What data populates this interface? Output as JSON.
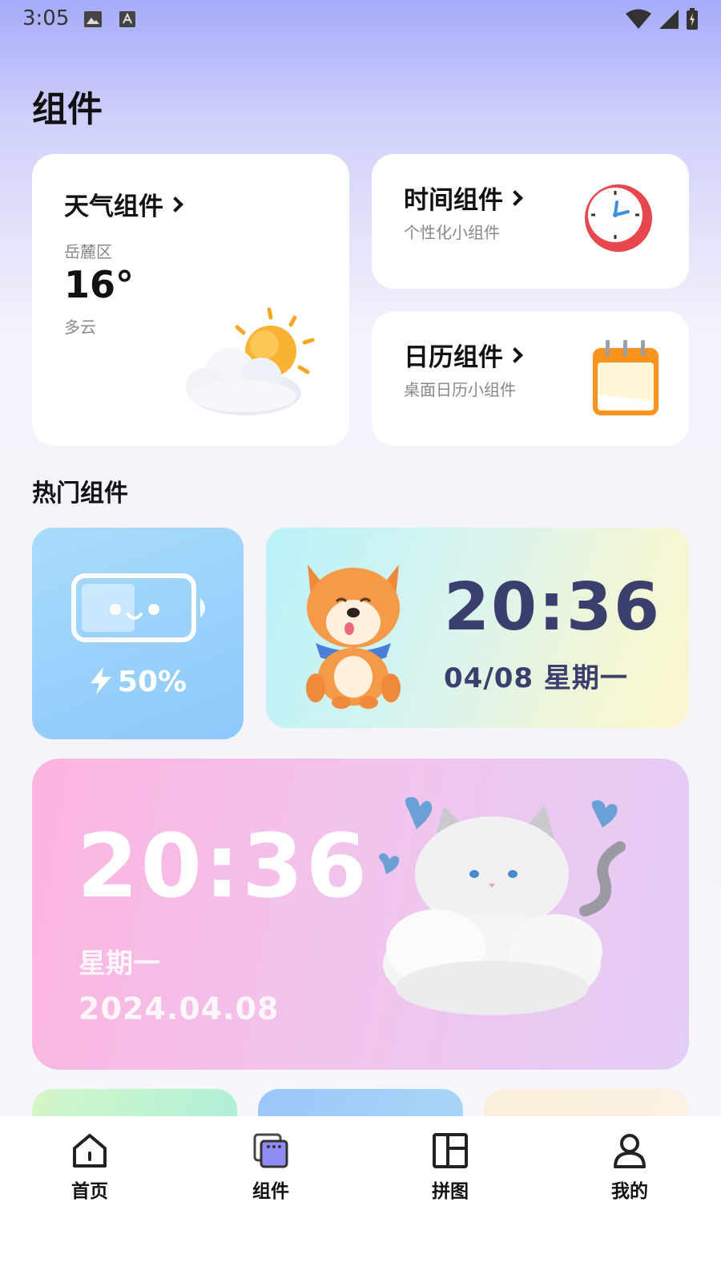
{
  "status_bar": {
    "time": "3:05"
  },
  "page": {
    "title": "组件"
  },
  "cards": {
    "weather": {
      "title": "天气组件",
      "location": "岳麓区",
      "temperature": "16°",
      "condition": "多云"
    },
    "time": {
      "title": "时间组件",
      "subtitle": "个性化小组件"
    },
    "calendar": {
      "title": "日历组件",
      "subtitle": "桌面日历小组件"
    }
  },
  "section": {
    "title": "热门组件"
  },
  "widgets": {
    "battery": {
      "level": "50%"
    },
    "dog_clock": {
      "time": "20:36",
      "date": "04/08  星期一"
    },
    "cat_clock": {
      "time": "20:36",
      "weekday": "星期一",
      "date": "2024.04.08"
    }
  },
  "tabbar": {
    "items": [
      {
        "label": "首页",
        "icon": "home-icon"
      },
      {
        "label": "组件",
        "icon": "widgets-icon",
        "active": true
      },
      {
        "label": "拼图",
        "icon": "puzzle-layout-icon"
      },
      {
        "label": "我的",
        "icon": "profile-icon"
      }
    ]
  },
  "colors": {
    "accent": "#8f8cf5",
    "clock_text": "#3b3f6e"
  }
}
